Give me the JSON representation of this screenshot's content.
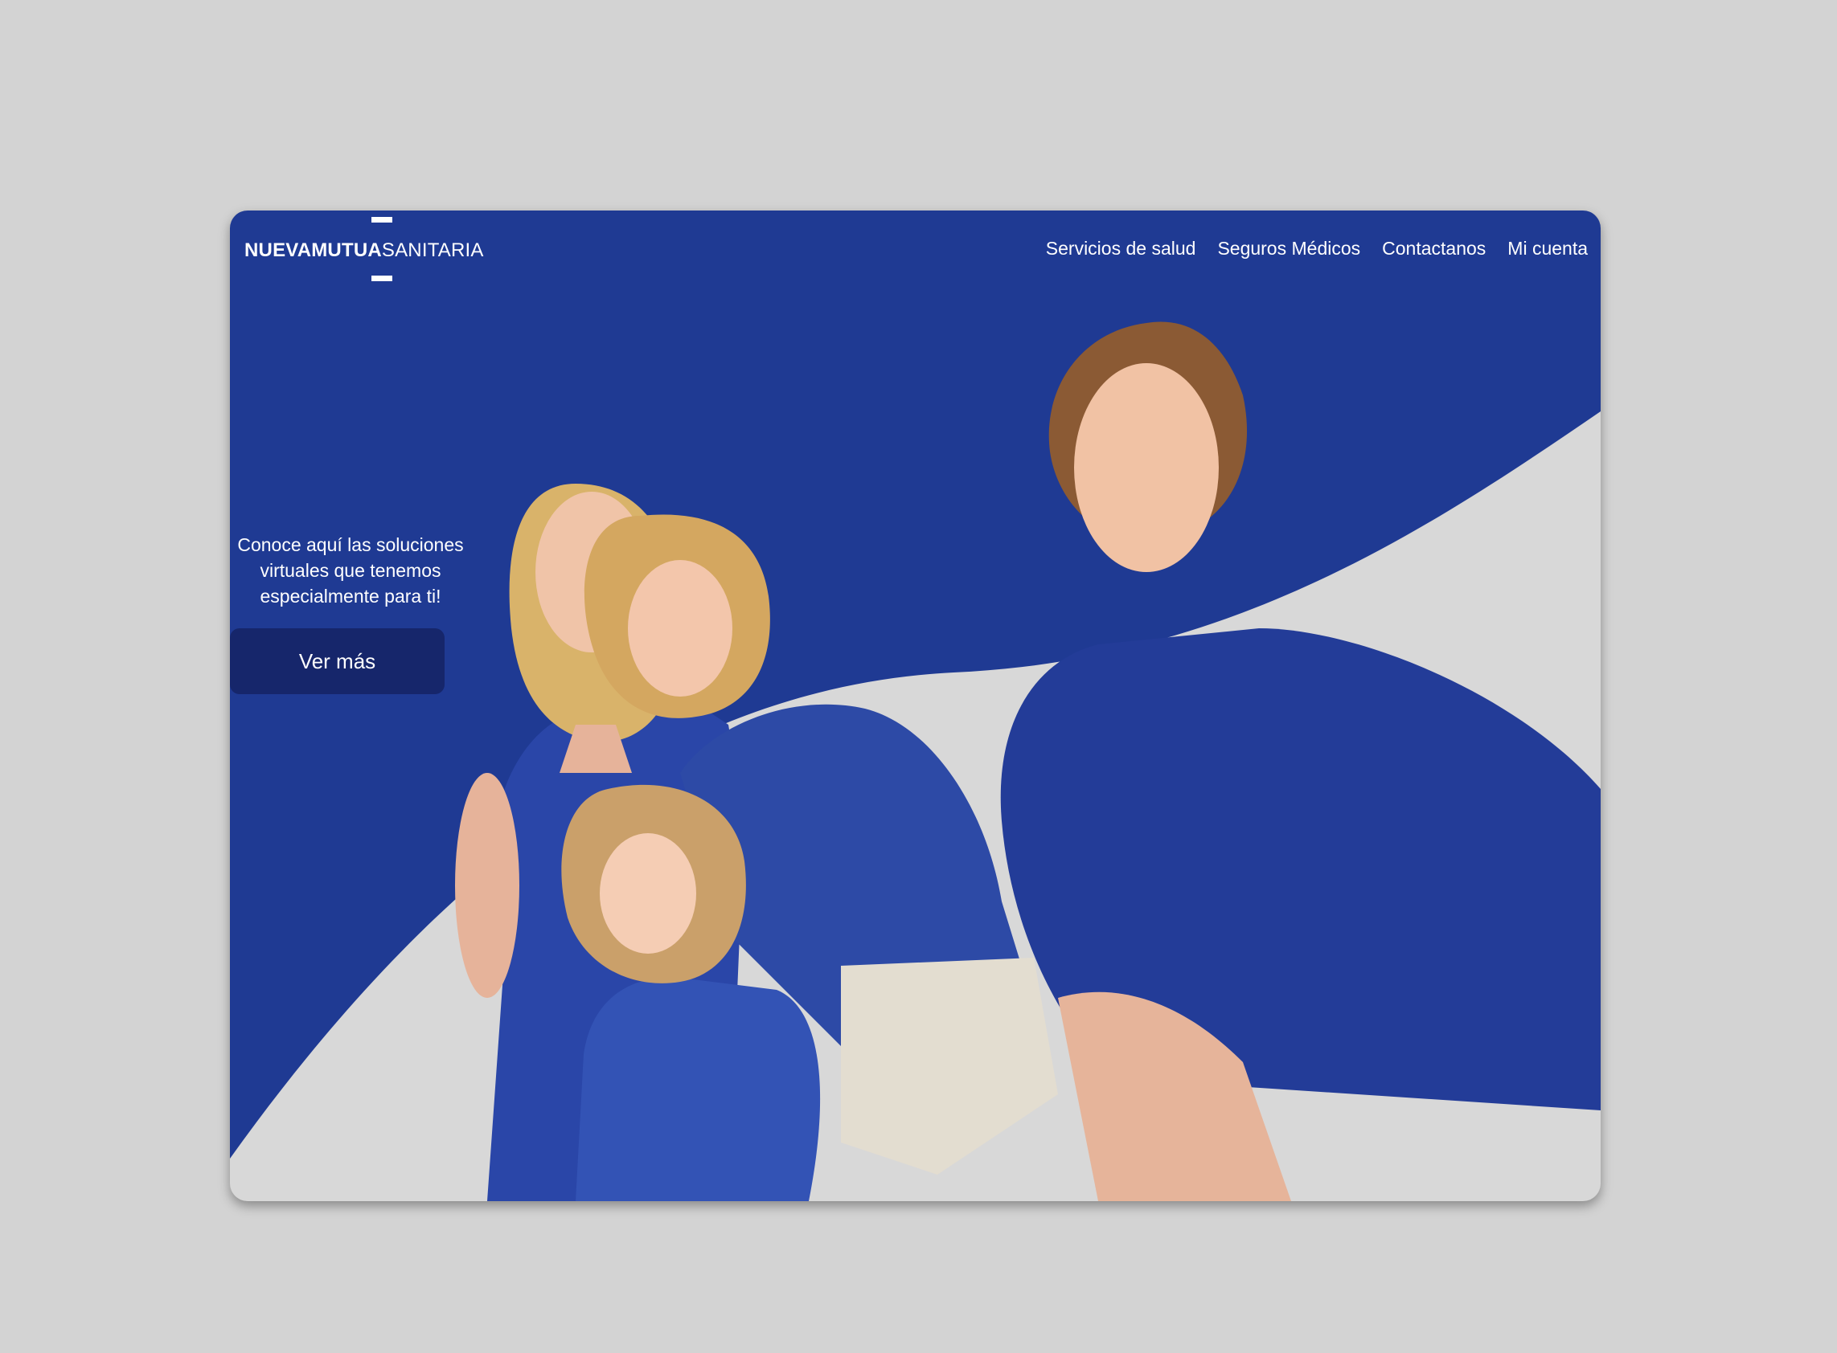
{
  "brand": {
    "logo_bold": "NUEVAMUTUA",
    "logo_light": "SANITARIA"
  },
  "nav": {
    "items": [
      {
        "label": "Servicios de salud"
      },
      {
        "label": "Seguros Médicos"
      },
      {
        "label": "Contactanos"
      },
      {
        "label": "Mi cuenta"
      }
    ]
  },
  "hero": {
    "text_line1": "Conoce aquí las soluciones",
    "text_line2": "virtuales que tenemos",
    "text_line3": "especialmente para ti!",
    "button_label": "Ver más",
    "image": "family-photo"
  },
  "colors": {
    "primary_blue": "#1f3a93",
    "button_navy": "#16266b",
    "light_gray": "#d8d8d8",
    "page_background": "#d3d3d3",
    "text_white": "#ffffff"
  }
}
